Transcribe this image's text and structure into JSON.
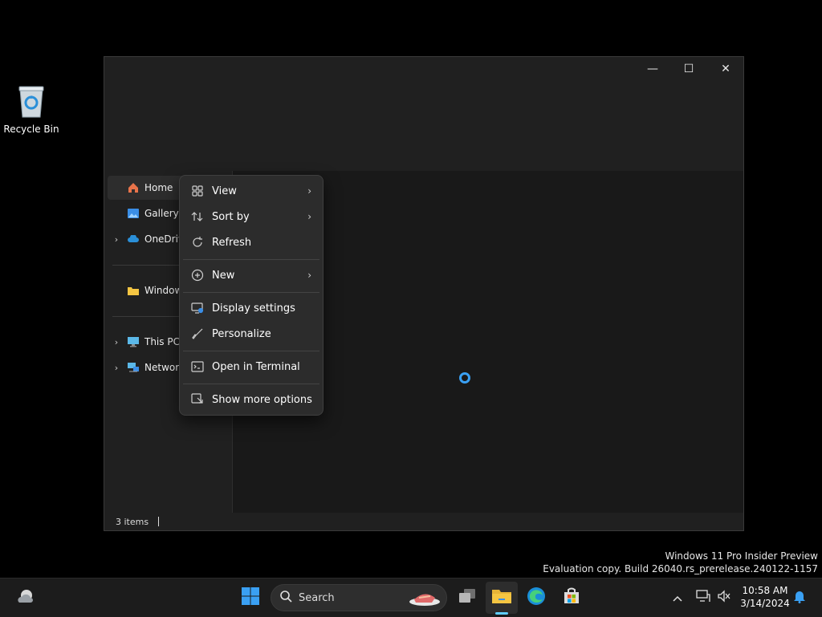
{
  "desktop": {
    "recycle_bin_label": "Recycle Bin"
  },
  "explorer": {
    "window_controls": {
      "minimize": "—",
      "maximize": "☐",
      "close": "✕"
    },
    "nav": {
      "home": "Home",
      "gallery": "Gallery",
      "onedrive": "OneDrive",
      "windows": "Windows",
      "this_pc": "This PC",
      "network": "Network"
    },
    "status": "3 items"
  },
  "context_menu": {
    "view": "View",
    "sort_by": "Sort by",
    "refresh": "Refresh",
    "new": "New",
    "display_settings": "Display settings",
    "personalize": "Personalize",
    "open_terminal": "Open in Terminal",
    "show_more": "Show more options"
  },
  "watermark": {
    "line1": "Windows 11 Pro Insider Preview",
    "line2": "Evaluation copy. Build 26040.rs_prerelease.240122-1157"
  },
  "taskbar": {
    "search_placeholder": "Search",
    "time": "10:58 AM",
    "date": "3/14/2024"
  },
  "colors": {
    "accent": "#60cdff",
    "folder": "#f4c542",
    "spinner": "#3aa0f3"
  }
}
